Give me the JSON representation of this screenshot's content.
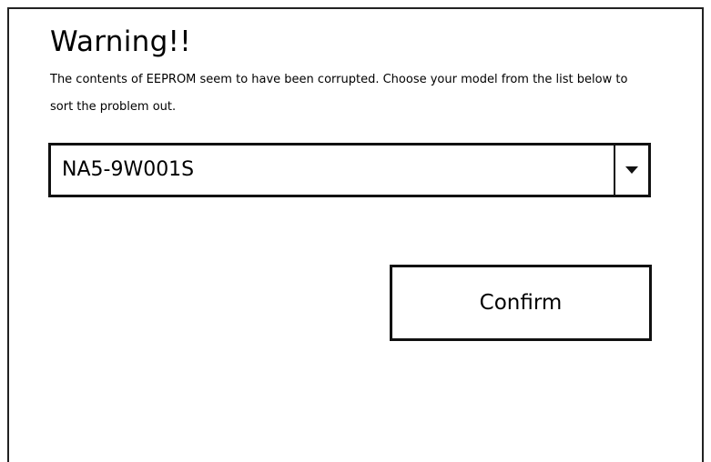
{
  "dialog": {
    "title": "Warning!!",
    "message": "The contents of EEPROM seem to have been corrupted. Choose your model from the list below to sort the problem out."
  },
  "model_select": {
    "selected_value": "NA5-9W001S",
    "arrow_icon": "caret-down-icon"
  },
  "confirm_button": {
    "label": "Confirm"
  }
}
